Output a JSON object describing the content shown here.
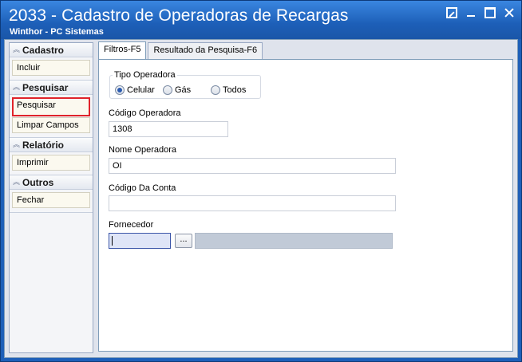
{
  "window": {
    "title": "2033 - Cadastro de Operadoras de Recargas",
    "subtitle": "Winthor - PC Sistemas"
  },
  "sidebar": {
    "groups": [
      {
        "title": "Cadastro",
        "items": [
          "Incluir"
        ]
      },
      {
        "title": "Pesquisar",
        "items": [
          "Pesquisar",
          "Limpar Campos"
        ]
      },
      {
        "title": "Relatório",
        "items": [
          "Imprimir"
        ]
      },
      {
        "title": "Outros",
        "items": [
          "Fechar"
        ]
      }
    ],
    "highlighted_item": "Pesquisar"
  },
  "tabs": [
    {
      "label": "Filtros-F5",
      "active": true
    },
    {
      "label": "Resultado da Pesquisa-F6",
      "active": false
    }
  ],
  "form": {
    "tipo_operadora": {
      "label": "Tipo Operadora",
      "options": [
        "Celular",
        "Gás",
        "Todos"
      ],
      "selected": "Celular"
    },
    "codigo_operadora": {
      "label": "Código Operadora",
      "value": "1308"
    },
    "nome_operadora": {
      "label": "Nome Operadora",
      "value": "OI"
    },
    "codigo_conta": {
      "label": "Código Da Conta",
      "value": ""
    },
    "fornecedor": {
      "label": "Fornecedor",
      "value": "",
      "browse_label": "..."
    }
  },
  "colors": {
    "titlebar": "#1d5fb8",
    "highlight_border": "#e0232b"
  }
}
